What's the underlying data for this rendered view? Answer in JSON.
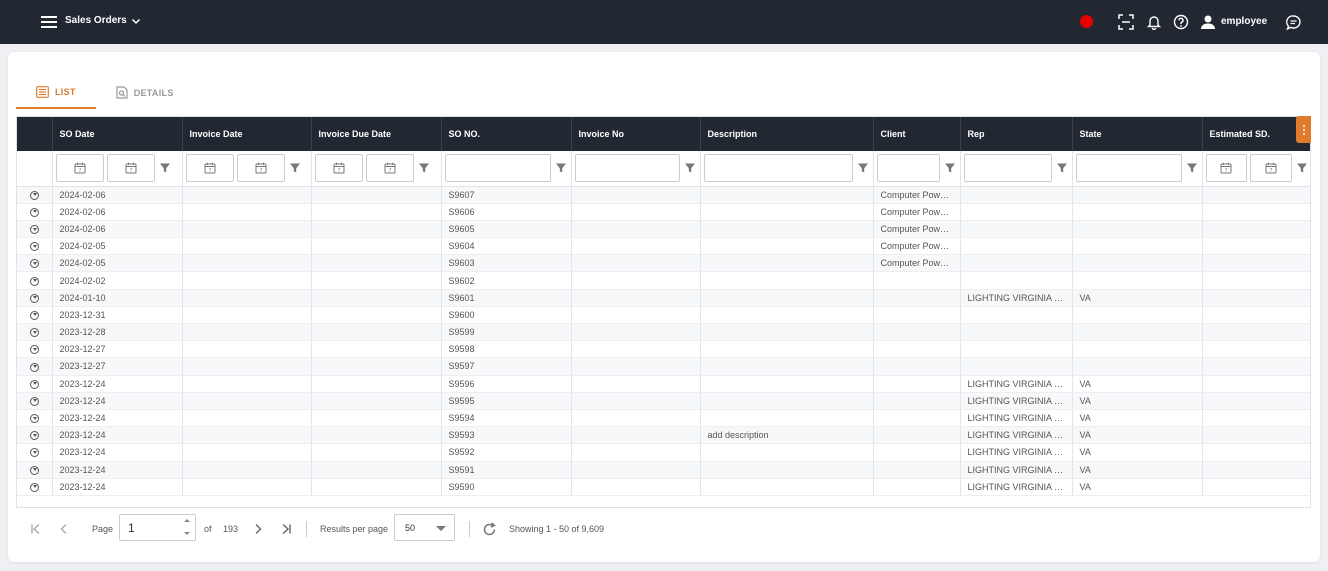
{
  "app": {
    "title": "Sales Orders",
    "user": "employee",
    "rec_color": "#e60000",
    "accent": "#e07b2e"
  },
  "tabs": [
    {
      "label": "LIST",
      "icon": "list-icon",
      "active": true
    },
    {
      "label": "DETAILS",
      "icon": "document-search-icon",
      "active": false
    }
  ],
  "columns": [
    "SO Date",
    "Invoice Date",
    "Invoice Due Date",
    "SO NO.",
    "Invoice No",
    "Description",
    "Client",
    "Rep",
    "State",
    "Estimated SD."
  ],
  "rows": [
    {
      "so_date": "2024-02-06",
      "so_no": "S9607",
      "description": "",
      "client": "Computer Power Systems",
      "rep": "",
      "state": ""
    },
    {
      "so_date": "2024-02-06",
      "so_no": "S9606",
      "description": "",
      "client": "Computer Power Systems",
      "rep": "",
      "state": ""
    },
    {
      "so_date": "2024-02-06",
      "so_no": "S9605",
      "description": "",
      "client": "Computer Power Systems",
      "rep": "",
      "state": ""
    },
    {
      "so_date": "2024-02-05",
      "so_no": "S9604",
      "description": "",
      "client": "Computer Power Systems",
      "rep": "",
      "state": ""
    },
    {
      "so_date": "2024-02-05",
      "so_no": "S9603",
      "description": "",
      "client": "Computer Power Systems",
      "rep": "",
      "state": ""
    },
    {
      "so_date": "2024-02-02",
      "so_no": "S9602",
      "description": "",
      "client": "",
      "rep": "",
      "state": ""
    },
    {
      "so_date": "2024-01-10",
      "so_no": "S9601",
      "description": "",
      "client": "",
      "rep": "LIGHTING VIRGINIA WEST",
      "state": "VA"
    },
    {
      "so_date": "2023-12-31",
      "so_no": "S9600",
      "description": "",
      "client": "",
      "rep": "",
      "state": ""
    },
    {
      "so_date": "2023-12-28",
      "so_no": "S9599",
      "description": "",
      "client": "",
      "rep": "",
      "state": ""
    },
    {
      "so_date": "2023-12-27",
      "so_no": "S9598",
      "description": "",
      "client": "",
      "rep": "",
      "state": ""
    },
    {
      "so_date": "2023-12-27",
      "so_no": "S9597",
      "description": "",
      "client": "",
      "rep": "",
      "state": ""
    },
    {
      "so_date": "2023-12-24",
      "so_no": "S9596",
      "description": "",
      "client": "",
      "rep": "LIGHTING VIRGINIA WEST",
      "state": "VA"
    },
    {
      "so_date": "2023-12-24",
      "so_no": "S9595",
      "description": "",
      "client": "",
      "rep": "LIGHTING VIRGINIA WEST",
      "state": "VA"
    },
    {
      "so_date": "2023-12-24",
      "so_no": "S9594",
      "description": "",
      "client": "",
      "rep": "LIGHTING VIRGINIA WEST",
      "state": "VA"
    },
    {
      "so_date": "2023-12-24",
      "so_no": "S9593",
      "description": "add description",
      "client": "",
      "rep": "LIGHTING VIRGINIA WEST",
      "state": "VA"
    },
    {
      "so_date": "2023-12-24",
      "so_no": "S9592",
      "description": "",
      "client": "",
      "rep": "LIGHTING VIRGINIA WEST",
      "state": "VA"
    },
    {
      "so_date": "2023-12-24",
      "so_no": "S9591",
      "description": "",
      "client": "",
      "rep": "LIGHTING VIRGINIA WEST",
      "state": "VA"
    },
    {
      "so_date": "2023-12-24",
      "so_no": "S9590",
      "description": "",
      "client": "",
      "rep": "LIGHTING VIRGINIA WEST",
      "state": "VA"
    }
  ],
  "pager": {
    "page_label": "Page",
    "page_value": "1",
    "of_label": "of",
    "total_pages": "193",
    "results_label": "Results per page",
    "per_page": "50",
    "showing": "Showing 1 - 50 of 9,609"
  }
}
